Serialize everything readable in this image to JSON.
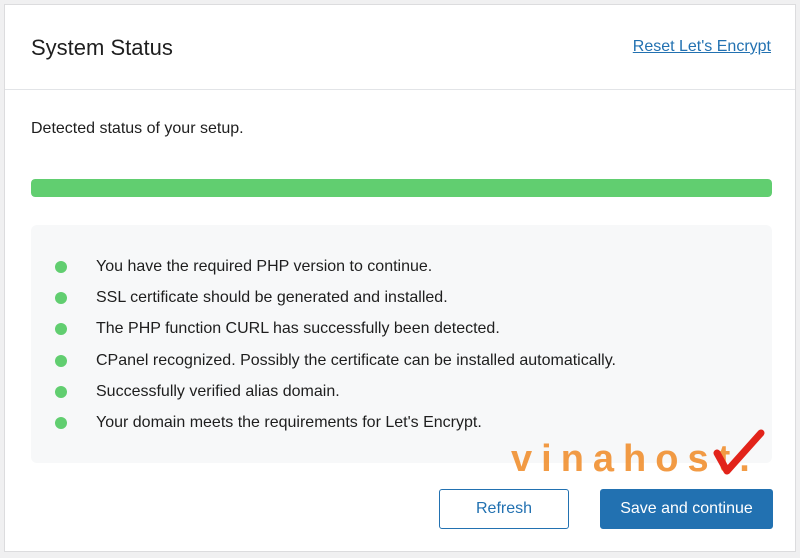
{
  "header": {
    "title": "System Status",
    "reset_link": "Reset Let's Encrypt"
  },
  "subtitle": "Detected status of your setup.",
  "progress": {
    "percent": 100,
    "color": "#61ce70"
  },
  "status_items": [
    {
      "text": "You have the required PHP version to continue.",
      "status": "success",
      "icon": "green-dot-icon"
    },
    {
      "text": "SSL certificate should be generated and installed.",
      "status": "success",
      "icon": "green-dot-icon"
    },
    {
      "text": "The PHP function CURL has successfully been detected.",
      "status": "success",
      "icon": "green-dot-icon"
    },
    {
      "text": "CPanel recognized. Possibly the certificate can be installed automatically.",
      "status": "success",
      "icon": "green-dot-icon"
    },
    {
      "text": "Successfully verified alias domain.",
      "status": "success",
      "icon": "green-dot-icon"
    },
    {
      "text": "Your domain meets the requirements for Let's Encrypt.",
      "status": "success",
      "icon": "green-dot-icon"
    }
  ],
  "watermark": {
    "text": "vinahost.",
    "icon": "red-checkmark-icon"
  },
  "buttons": {
    "refresh": "Refresh",
    "save": "Save and continue"
  },
  "colors": {
    "accent": "#2271b1",
    "success": "#61ce70",
    "watermark_orange": "#f08a24",
    "watermark_red": "#e2231a"
  }
}
